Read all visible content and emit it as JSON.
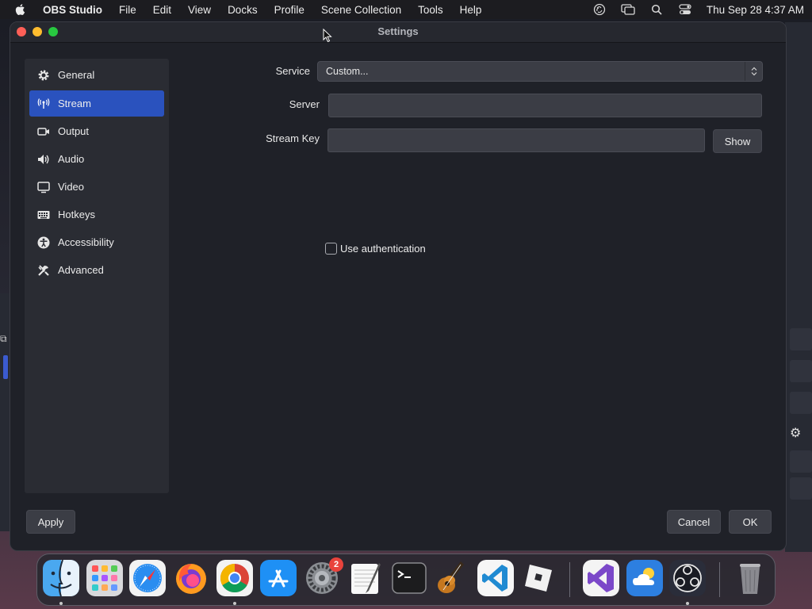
{
  "menubar": {
    "app_name": "OBS Studio",
    "items": [
      "File",
      "Edit",
      "View",
      "Docks",
      "Profile",
      "Scene Collection",
      "Tools",
      "Help"
    ],
    "clock": "Thu Sep 28  4:37 AM",
    "tray_icons": [
      "obs-tray-icon",
      "screen-mirroring-icon",
      "spotlight-search-icon",
      "control-center-icon"
    ]
  },
  "settings_window": {
    "title": "Settings",
    "sidebar": [
      {
        "label": "General",
        "icon": "gear-icon"
      },
      {
        "label": "Stream",
        "icon": "antenna-icon",
        "active": true
      },
      {
        "label": "Output",
        "icon": "output-icon"
      },
      {
        "label": "Audio",
        "icon": "speaker-icon"
      },
      {
        "label": "Video",
        "icon": "monitor-icon"
      },
      {
        "label": "Hotkeys",
        "icon": "keyboard-icon"
      },
      {
        "label": "Accessibility",
        "icon": "accessibility-icon"
      },
      {
        "label": "Advanced",
        "icon": "tools-icon"
      }
    ],
    "stream": {
      "service_label": "Service",
      "service_value": "Custom...",
      "server_label": "Server",
      "server_value": "",
      "stream_key_label": "Stream Key",
      "stream_key_value": "",
      "show_button": "Show",
      "use_auth_label": "Use authentication",
      "use_auth_checked": false
    },
    "buttons": {
      "apply": "Apply",
      "cancel": "Cancel",
      "ok": "OK"
    }
  },
  "dock": {
    "apps": [
      "Finder",
      "Launchpad",
      "Safari",
      "Firefox",
      "Google Chrome",
      "App Store",
      "System Settings",
      "TextEdit",
      "Terminal",
      "GarageBand",
      "Visual Studio Code",
      "Roblox",
      "Visual Studio",
      "Weather",
      "OBS Studio",
      "Trash"
    ],
    "system_settings_badge": "2"
  },
  "colors": {
    "accent": "#2a52be",
    "window_bg": "#1f2128",
    "sidebar_bg": "#2a2c33",
    "input_bg": "#3b3d45"
  }
}
